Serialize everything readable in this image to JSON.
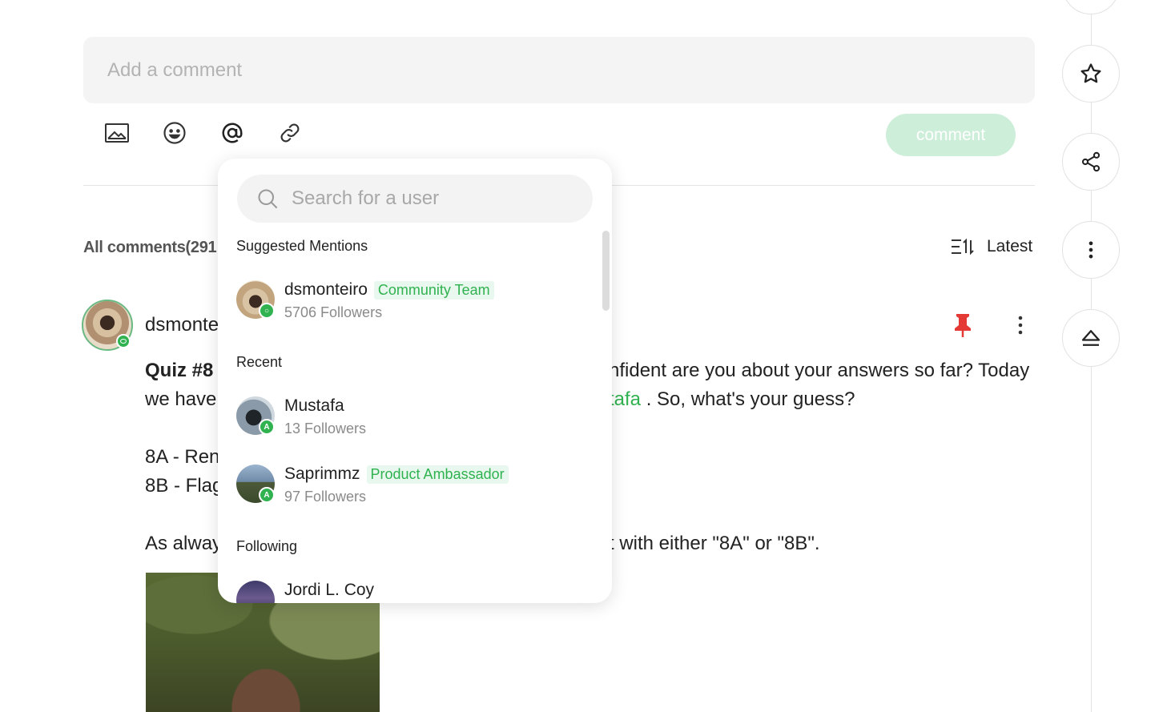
{
  "composer": {
    "placeholder": "Add a comment",
    "submit_label": "comment",
    "tools": [
      "image-icon",
      "emoji-icon",
      "mention-icon",
      "link-icon"
    ]
  },
  "comments_header": {
    "title": "All comments(291",
    "sort_label": "Latest"
  },
  "rail": {
    "buttons": [
      "star-icon",
      "share-icon",
      "more-vertical-icon",
      "eject-icon"
    ]
  },
  "comment": {
    "author": "dsmonte",
    "line1_left_bold": "Quiz #8",
    "line1_right": "nfident are you about your answers so far? Today",
    "line2_left": "we have",
    "line2_mention": "tafa",
    "line2_right": " . So, what's your guess?",
    "line3_left": "8A - Ren",
    "line4_left": "8B - Flag",
    "line5_left": "As alway",
    "line5_right": "t with either \"8A\" or \"8B\"."
  },
  "mention_dropdown": {
    "search_placeholder": "Search for a user",
    "sections": {
      "suggested": "Suggested Mentions",
      "recent": "Recent",
      "following": "Following"
    },
    "suggested_users": [
      {
        "name": "dsmonteiro",
        "role": "Community Team",
        "followers": "5706 Followers"
      }
    ],
    "recent_users": [
      {
        "name": "Mustafa",
        "badge": "A",
        "followers": "13 Followers"
      },
      {
        "name": "Saprimmz",
        "role": "Product Ambassador",
        "badge": "A",
        "followers": "97 Followers"
      }
    ],
    "following_users": [
      {
        "name": "Jordi L. Coy"
      }
    ]
  },
  "colors": {
    "accent": "#2fb24f",
    "comment_button_disabled": "#cdeed9",
    "pin": "#e53935"
  }
}
